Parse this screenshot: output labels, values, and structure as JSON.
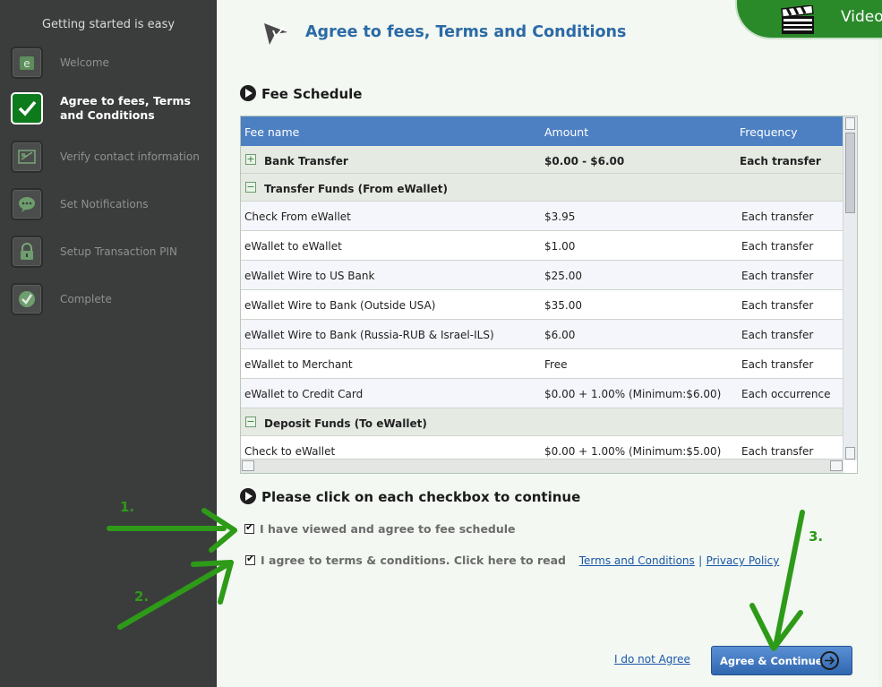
{
  "sidebar": {
    "title": "Getting started is easy",
    "steps": [
      {
        "label": "Welcome",
        "icon": "ewallet-icon",
        "active": false
      },
      {
        "label": "Agree to fees, Terms and Conditions",
        "line1": "Agree to fees, Terms",
        "line2": "and Conditions",
        "icon": "checkmark-icon",
        "active": true
      },
      {
        "label": "Verify contact information",
        "icon": "contact-card-icon",
        "active": false
      },
      {
        "label": "Set Notifications",
        "icon": "speech-bubble-icon",
        "active": false
      },
      {
        "label": "Setup Transaction PIN",
        "icon": "padlock-icon",
        "active": false
      },
      {
        "label": "Complete",
        "icon": "checkmark-badge-icon",
        "active": false
      }
    ]
  },
  "header": {
    "title": "Agree to fees, Terms and Conditions",
    "video_label": "Video"
  },
  "fee_schedule": {
    "heading": "Fee Schedule",
    "columns": [
      "Fee name",
      "Amount",
      "Frequency"
    ],
    "rows": [
      {
        "type": "group",
        "toggle": "+",
        "name": "Bank Transfer",
        "amount": "$0.00 - $6.00",
        "frequency": "Each transfer"
      },
      {
        "type": "group",
        "toggle": "−",
        "name": "Transfer Funds (From eWallet)",
        "amount": "",
        "frequency": ""
      },
      {
        "type": "item",
        "name": "Check From eWallet",
        "amount": "$3.95",
        "frequency": "Each transfer"
      },
      {
        "type": "item",
        "name": "eWallet to eWallet",
        "amount": "$1.00",
        "frequency": "Each transfer"
      },
      {
        "type": "item",
        "name": "eWallet Wire to US Bank",
        "amount": "$25.00",
        "frequency": "Each transfer"
      },
      {
        "type": "item",
        "name": "eWallet Wire to Bank (Outside USA)",
        "amount": "$35.00",
        "frequency": "Each transfer"
      },
      {
        "type": "item",
        "name": "eWallet Wire to Bank (Russia-RUB & Israel-ILS)",
        "amount": "$6.00",
        "frequency": "Each transfer"
      },
      {
        "type": "item",
        "name": "eWallet to Merchant",
        "amount": "Free",
        "frequency": "Each transfer"
      },
      {
        "type": "item",
        "name": "eWallet to Credit Card",
        "amount": "$0.00 + 1.00% (Minimum:$6.00)",
        "frequency": "Each occurrence"
      },
      {
        "type": "group",
        "toggle": "−",
        "name": "Deposit Funds (To eWallet)",
        "amount": "",
        "frequency": ""
      },
      {
        "type": "item",
        "name": "Check to eWallet",
        "amount": "$0.00 + 1.00% (Minimum:$5.00)",
        "frequency": "Each transfer"
      }
    ]
  },
  "consent": {
    "heading": "Please click on each checkbox to continue",
    "checkbox1_label": "I have viewed and agree to fee schedule",
    "checkbox1_checked": true,
    "checkbox2_label": "I agree to terms & conditions. Click here to read",
    "checkbox2_checked": true,
    "terms_link": "Terms and Conditions",
    "separator": "|",
    "privacy_link": "Privacy Policy"
  },
  "actions": {
    "not_agree": "I do not Agree",
    "agree_continue": "Agree & Continue"
  },
  "annotations": {
    "a1": "1.",
    "a2": "2.",
    "a3": "3.",
    "color": "#2d9a18"
  }
}
